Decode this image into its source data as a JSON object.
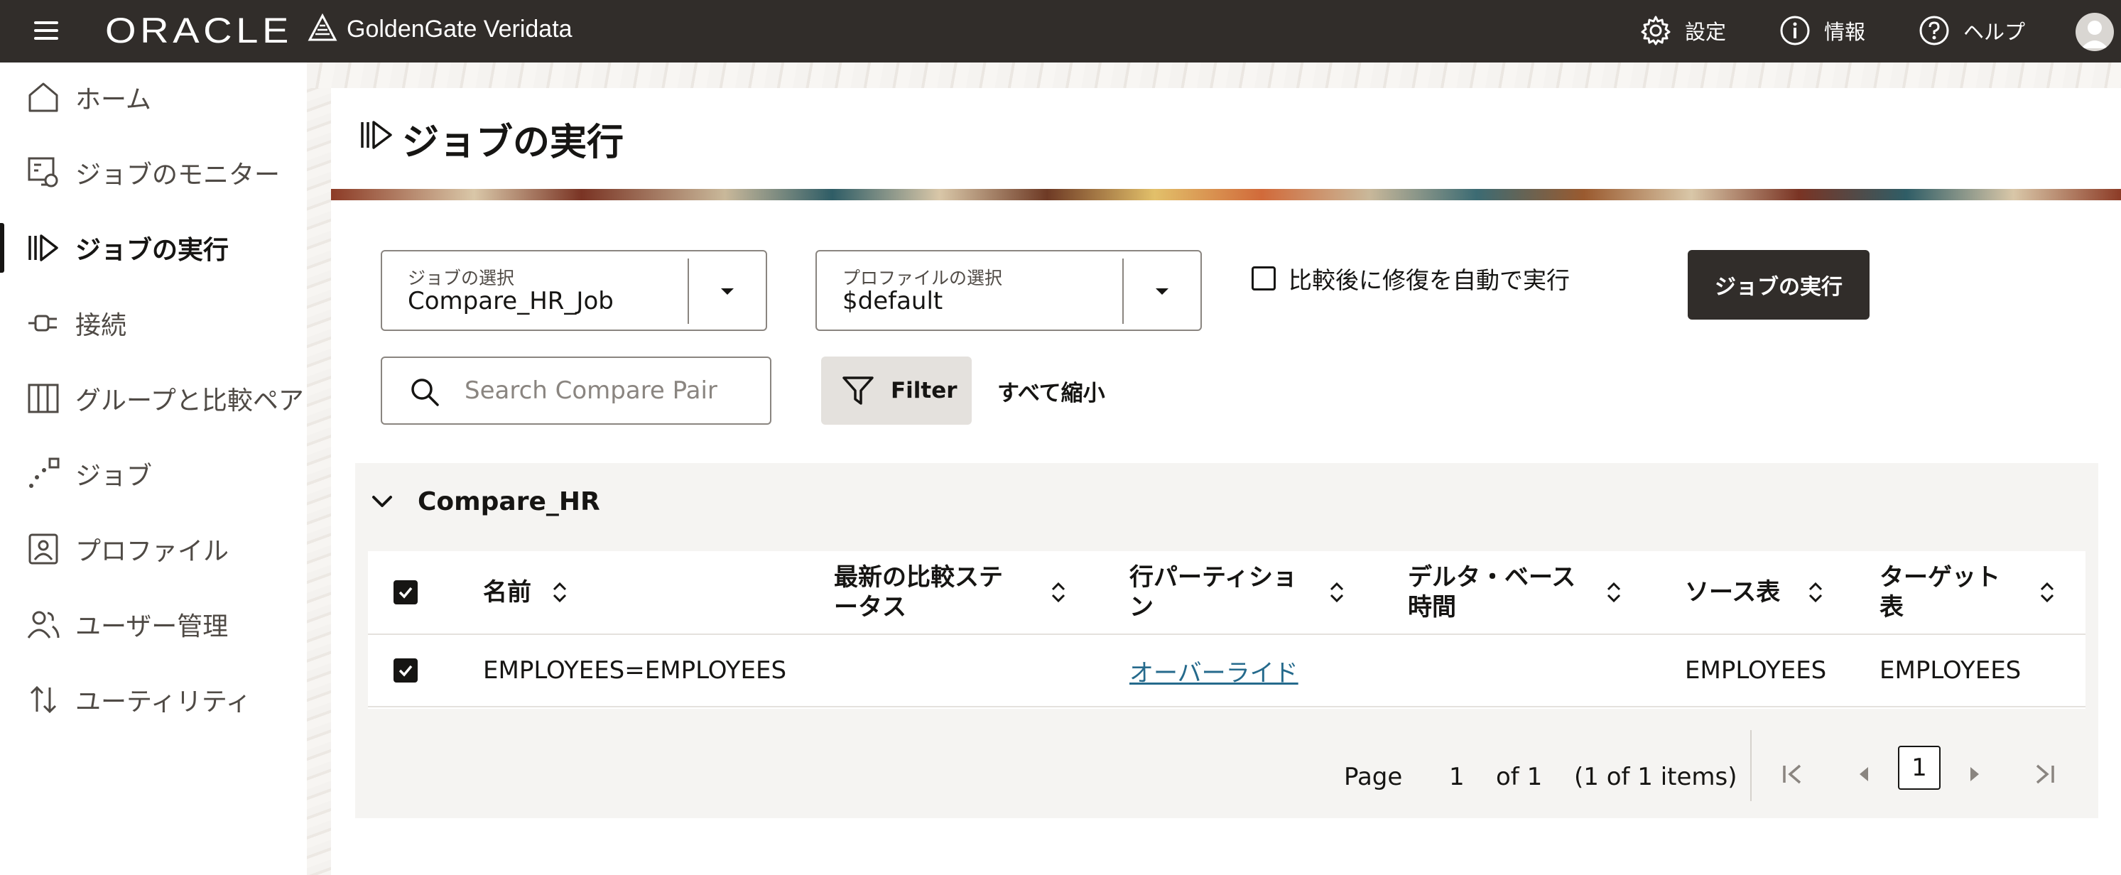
{
  "header": {
    "brand": "ORACLE",
    "product": "GoldenGate Veridata",
    "actions": [
      {
        "label": "設定",
        "icon": "gear-icon"
      },
      {
        "label": "情報",
        "icon": "info-icon"
      },
      {
        "label": "ヘルプ",
        "icon": "help-icon"
      }
    ]
  },
  "sidebar": {
    "items": [
      {
        "label": "ホーム",
        "icon": "home-icon"
      },
      {
        "label": "ジョブのモニター",
        "icon": "monitor-icon"
      },
      {
        "label": "ジョブの実行",
        "icon": "run-job-icon",
        "active": true
      },
      {
        "label": "接続",
        "icon": "plug-icon"
      },
      {
        "label": "グループと比較ペア",
        "icon": "columns-icon"
      },
      {
        "label": "ジョブ",
        "icon": "job-icon"
      },
      {
        "label": "プロファイル",
        "icon": "profile-icon"
      },
      {
        "label": "ユーザー管理",
        "icon": "users-icon"
      },
      {
        "label": "ユーティリティ",
        "icon": "utility-icon"
      }
    ]
  },
  "page": {
    "title": "ジョブの実行"
  },
  "form": {
    "job_select": {
      "label": "ジョブの選択",
      "value": "Compare_HR_Job"
    },
    "profile_select": {
      "label": "プロファイルの選択",
      "value": "$default"
    },
    "auto_repair": {
      "label": "比較後に修復を自動で実行",
      "checked": false
    },
    "run_button": "ジョブの実行",
    "search": {
      "placeholder": "Search Compare Pair"
    },
    "filter_button": "Filter",
    "collapse_all": "すべて縮小"
  },
  "group": {
    "name": "Compare_HR",
    "columns": [
      {
        "label": "名前"
      },
      {
        "label": "最新の比較ステータス"
      },
      {
        "label": "行パーティション"
      },
      {
        "label": "デルタ・ベース時間"
      },
      {
        "label": "ソース表"
      },
      {
        "label": "ターゲット表"
      }
    ],
    "rows": [
      {
        "checked": true,
        "name": "EMPLOYEES=EMPLOYEES",
        "status": "",
        "row_partition": "オーバーライド",
        "delta_base_time": "",
        "source_table": "EMPLOYEES",
        "target_table": "EMPLOYEES"
      }
    ],
    "header_checked": true
  },
  "pagination": {
    "page_label": "Page",
    "page_value": "1",
    "of_label": "of 1",
    "items_label": "(1 of 1 items)",
    "current": "1"
  },
  "colors": {
    "topbar": "#312d2a",
    "primary_button": "#312d2a",
    "link": "#256a8c",
    "panel": "#f5f4f2"
  }
}
